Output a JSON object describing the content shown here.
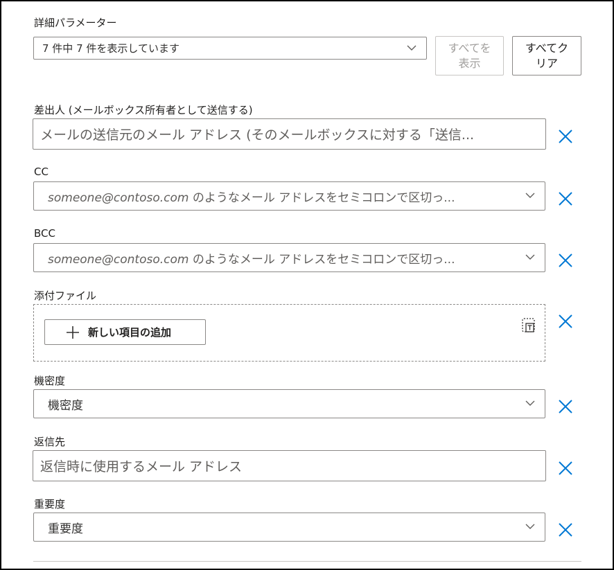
{
  "header": {
    "title": "詳細パラメーター",
    "filter_value": "7 件中 7 件を表示しています",
    "show_all_label": "すべてを\n表示",
    "clear_all_label": "すべてク\nリア"
  },
  "fields": {
    "from": {
      "label": "差出人 (メールボックス所有者として送信する)",
      "placeholder": "メールの送信元のメール アドレス (そのメールボックスに対する「送信..."
    },
    "cc": {
      "label": "CC",
      "placeholder_italic": "someone@contoso.com",
      "placeholder_rest": " のようなメール アドレスをセミコロンで区切っ..."
    },
    "bcc": {
      "label": "BCC",
      "placeholder_italic": "someone@contoso.com",
      "placeholder_rest": " のようなメール アドレスをセミコロンで区切っ..."
    },
    "attachments": {
      "label": "添付ファイル",
      "add_button": "新しい項目の追加"
    },
    "sensitivity": {
      "label": "機密度",
      "value": "機密度"
    },
    "reply_to": {
      "label": "返信先",
      "placeholder": "返信時に使用するメール アドレス"
    },
    "importance": {
      "label": "重要度",
      "value": "重要度"
    }
  },
  "colors": {
    "accent": "#0078d4",
    "border": "#8a8886",
    "text": "#323130"
  },
  "icons": {
    "remove": "close-icon",
    "dropdown": "chevron-down-icon",
    "add": "plus-icon",
    "dynamic": "dynamic-content-icon"
  }
}
